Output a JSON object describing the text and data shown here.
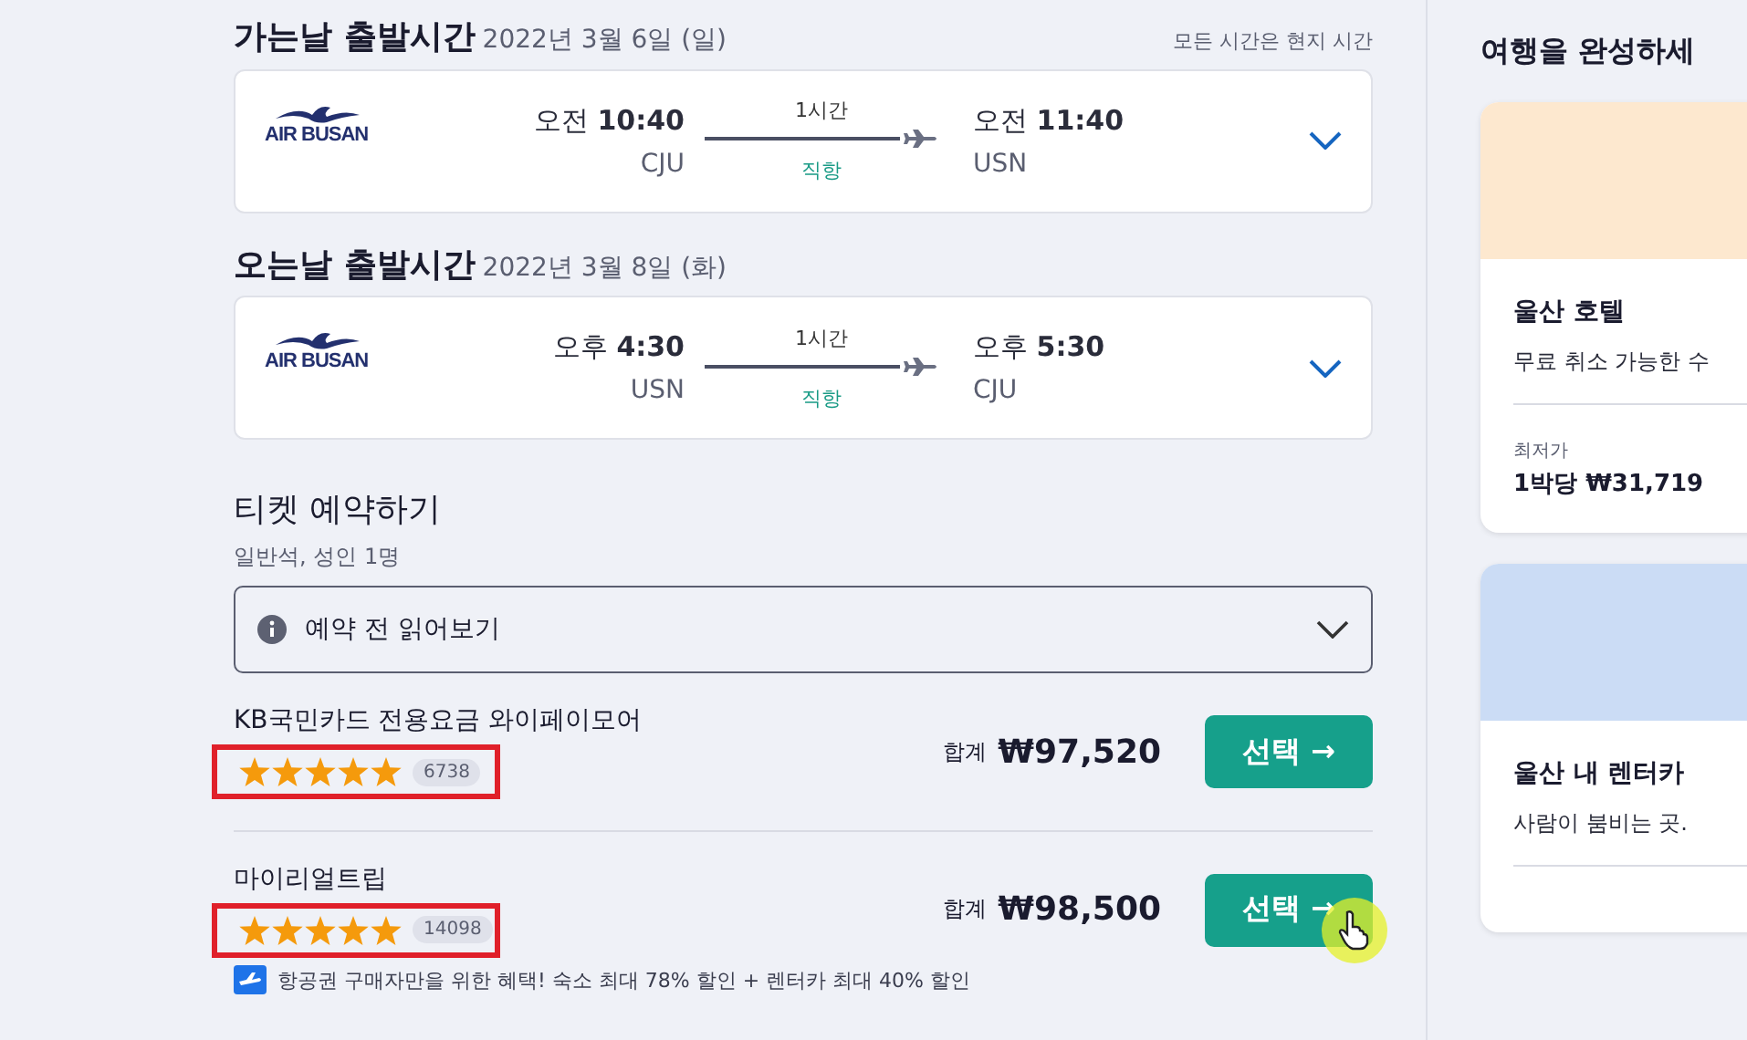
{
  "flights": [
    {
      "heading": "가는날 출발시간",
      "date": "2022년 3월 6일 (일)",
      "note": "모든 시간은 현지 시간",
      "airline": "AIR BUSAN",
      "dep_time_prefix": "오전",
      "dep_time": "10:40",
      "dep_airport": "CJU",
      "duration": "1시간",
      "stops": "직항",
      "arr_time_prefix": "오전",
      "arr_time": "11:40",
      "arr_airport": "USN"
    },
    {
      "heading": "오는날 출발시간",
      "date": "2022년 3월 8일 (화)",
      "airline": "AIR BUSAN",
      "dep_time_prefix": "오후",
      "dep_time": "4:30",
      "dep_airport": "USN",
      "duration": "1시간",
      "stops": "직항",
      "arr_time_prefix": "오후",
      "arr_time": "5:30",
      "arr_airport": "CJU"
    }
  ],
  "booking": {
    "title": "티켓 예약하기",
    "subtitle": "일반석, 성인 1명",
    "dropdown": "예약 전 읽어보기",
    "offers": [
      {
        "name": "KB국민카드 전용요금 와이페이모어",
        "stars": 5,
        "reviews": "6738",
        "total_label": "합계",
        "price": "₩97,520",
        "button": "선택 →",
        "highlighted": true
      },
      {
        "name": "마이리얼트립",
        "stars": 5,
        "reviews": "14098",
        "total_label": "합계",
        "price": "₩98,500",
        "button": "선택 →",
        "highlighted": true
      }
    ],
    "promo": "항공권 구매자만을 위한 혜택! 숙소 최대 78% 할인 + 렌터카 최대 40% 할인"
  },
  "sidebar": {
    "title": "여행을 완성하세",
    "cards": [
      {
        "color": "#fde8cf",
        "title": "울산 호텔",
        "desc": "무료 취소 가능한 수",
        "label": "최저가",
        "price": "1박당 ₩31,719"
      },
      {
        "color": "#cbdcf5",
        "title": "울산 내 렌터카",
        "desc": "사람이 붐비는 곳."
      }
    ]
  }
}
